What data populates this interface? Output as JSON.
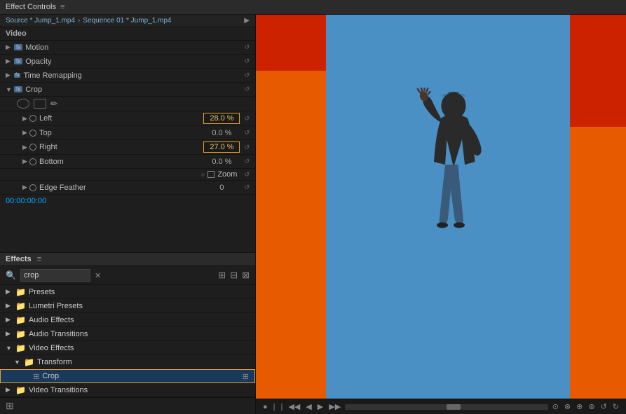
{
  "titleBar": {
    "title": "Effect Controls",
    "menuIcon": "≡"
  },
  "effectControls": {
    "source1": "Source * Jump_1.mp4",
    "source2": "Sequence 01 * Jump_1.mp4",
    "arrowIcon": "▶",
    "sectionLabel": "Video",
    "effects": [
      {
        "name": "Motion",
        "type": "fx",
        "hasArrow": true
      },
      {
        "name": "Opacity",
        "type": "fx",
        "hasArrow": true
      },
      {
        "name": "Time Remapping",
        "type": "fx",
        "hasArrow": true
      }
    ],
    "crop": {
      "label": "Crop",
      "type": "fx",
      "params": [
        {
          "name": "Left",
          "value": "28.0 %",
          "highlighted": true
        },
        {
          "name": "Top",
          "value": "0.0 %",
          "highlighted": false
        },
        {
          "name": "Right",
          "value": "27.0 %",
          "highlighted": true
        },
        {
          "name": "Bottom",
          "value": "0.0 %",
          "highlighted": false
        }
      ],
      "zoom": {
        "label": "Zoom"
      },
      "edgeFeather": {
        "name": "Edge Feather",
        "value": "0"
      }
    },
    "timecode": "00:00:00:00"
  },
  "effects": {
    "title": "Effects",
    "menuIcon": "≡",
    "search": {
      "placeholder": "crop",
      "value": "crop"
    },
    "items": [
      {
        "type": "folder",
        "name": "Presets",
        "indent": 0,
        "expanded": false
      },
      {
        "type": "folder",
        "name": "Lumetri Presets",
        "indent": 0,
        "expanded": false
      },
      {
        "type": "folder",
        "name": "Audio Effects",
        "indent": 0,
        "expanded": false
      },
      {
        "type": "folder",
        "name": "Audio Transitions",
        "indent": 0,
        "expanded": false
      },
      {
        "type": "folder",
        "name": "Video Effects",
        "indent": 0,
        "expanded": true
      },
      {
        "type": "folder",
        "name": "Transform",
        "indent": 1,
        "expanded": true
      },
      {
        "type": "file",
        "name": "Crop",
        "indent": 2,
        "selected": true
      },
      {
        "type": "folder",
        "name": "Video Transitions",
        "indent": 0,
        "expanded": false
      }
    ]
  },
  "preview": {
    "controls": [
      "●",
      "▏",
      "▏",
      "◀◀",
      "◀",
      "▶",
      "▶▶",
      "◉",
      "⊙",
      "⊗",
      "⊕",
      "⊛",
      "↺",
      "↻"
    ]
  }
}
